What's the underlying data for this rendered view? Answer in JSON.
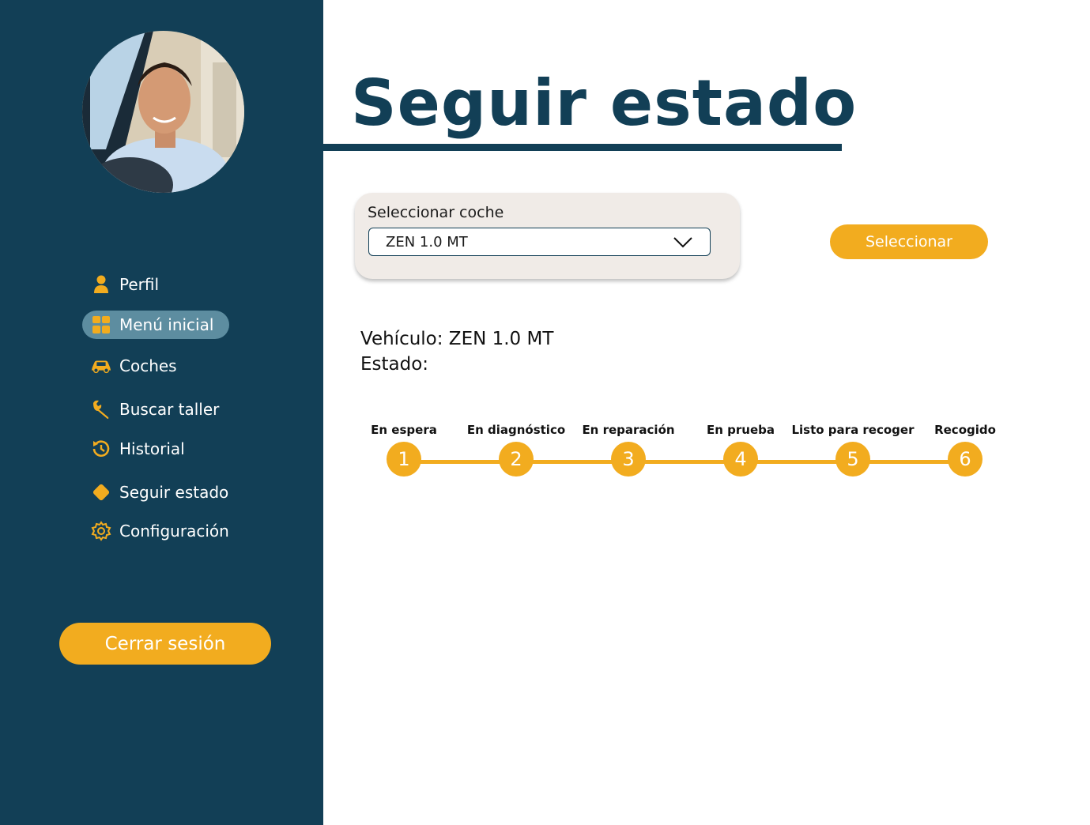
{
  "sidebar": {
    "avatar_alt": "",
    "items": [
      {
        "label": "Perfil",
        "icon": "person-icon"
      },
      {
        "label": "Menú inicial",
        "icon": "dashboard-icon"
      },
      {
        "label": "Coches",
        "icon": "car-icon"
      },
      {
        "label": "Buscar taller",
        "icon": "wrench-icon"
      },
      {
        "label": "Historial",
        "icon": "history-icon"
      },
      {
        "label": "Seguir estado",
        "icon": "diamond-icon"
      },
      {
        "label": "Configuración",
        "icon": "gear-icon"
      }
    ],
    "active_item": "Menú inicial",
    "logout_label": "Cerrar sesión"
  },
  "main": {
    "title": "Seguir estado",
    "car_select": {
      "label": "Seleccionar coche",
      "value": "ZEN 1.0 MT"
    },
    "select_button": "Seleccionar",
    "vehicle_line": "Vehículo: ZEN 1.0 MT",
    "status_line": "Estado:",
    "steps": [
      {
        "label": "En espera",
        "number": "1"
      },
      {
        "label": "En diagnóstico",
        "number": "2"
      },
      {
        "label": "En reparación",
        "number": "3"
      },
      {
        "label": "En prueba",
        "number": "4"
      },
      {
        "label": "Listo para recoger",
        "number": "5"
      },
      {
        "label": "Recogido",
        "number": "6"
      }
    ]
  },
  "colors": {
    "sidebar": "#123f56",
    "accent": "#f2ac1f",
    "active_item": "#5d8da0",
    "card": "#f0ebe7"
  }
}
